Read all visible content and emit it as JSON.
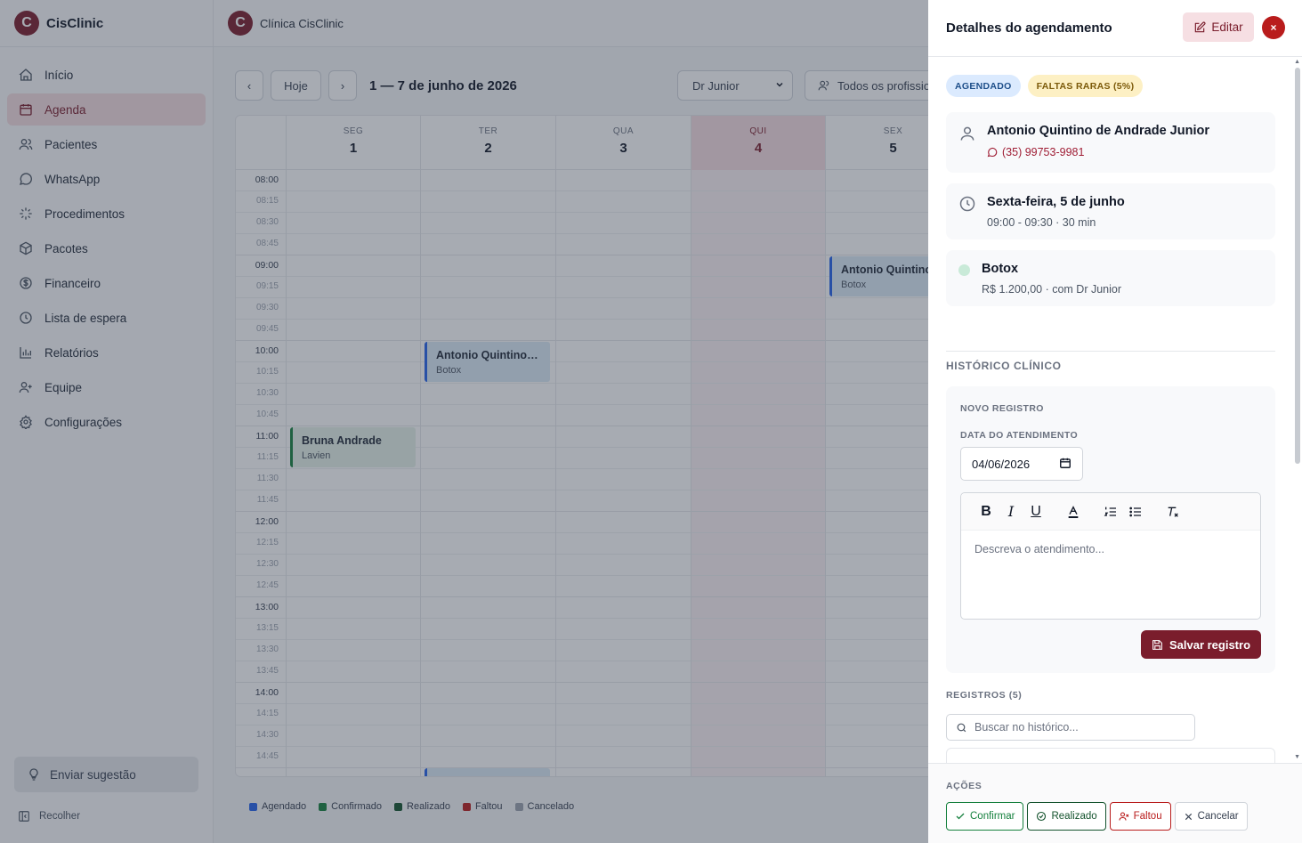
{
  "brand": {
    "name": "CisClinic",
    "logo_letter": "C",
    "color": "#7a1d2c"
  },
  "topbar": {
    "clinic_name": "Clínica CisClinic"
  },
  "sidebar": {
    "items": [
      {
        "label": "Início",
        "icon": "home-icon"
      },
      {
        "label": "Agenda",
        "icon": "calendar-icon",
        "active": true
      },
      {
        "label": "Pacientes",
        "icon": "users-icon"
      },
      {
        "label": "WhatsApp",
        "icon": "whatsapp-icon"
      },
      {
        "label": "Procedimentos",
        "icon": "sparkle-icon"
      },
      {
        "label": "Pacotes",
        "icon": "package-icon"
      },
      {
        "label": "Financeiro",
        "icon": "dollar-icon"
      },
      {
        "label": "Lista de espera",
        "icon": "clock-icon"
      },
      {
        "label": "Relatórios",
        "icon": "chart-icon"
      },
      {
        "label": "Equipe",
        "icon": "user-plus-icon"
      },
      {
        "label": "Configurações",
        "icon": "gear-icon"
      }
    ],
    "suggest_label": "Enviar sugestão",
    "collapse_label": "Recolher"
  },
  "calendar": {
    "today_label": "Hoje",
    "range_label": "1 — 7 de junho de 2026",
    "professional_select": "Dr Junior",
    "all_professionals": "Todos os profissionais",
    "days": [
      {
        "name": "SEG",
        "num": "1"
      },
      {
        "name": "TER",
        "num": "2"
      },
      {
        "name": "QUA",
        "num": "3"
      },
      {
        "name": "QUI",
        "num": "4",
        "today": true
      },
      {
        "name": "SEX",
        "num": "5"
      }
    ],
    "times": [
      "08:00",
      "08:15",
      "08:30",
      "08:45",
      "09:00",
      "09:15",
      "09:30",
      "09:45",
      "10:00",
      "10:15",
      "10:30",
      "10:45",
      "11:00",
      "11:15",
      "11:30",
      "11:45",
      "12:00",
      "12:15",
      "12:30",
      "12:45",
      "13:00",
      "13:15",
      "13:30",
      "13:45",
      "14:00",
      "14:15",
      "14:30",
      "14:45"
    ],
    "events": [
      {
        "day": 4,
        "start": "09:00",
        "end": "09:30",
        "name": "Antonio Quintino",
        "service": "Botox",
        "status": "agendado"
      },
      {
        "day": 1,
        "start": "10:00",
        "end": "10:30",
        "name": "Antonio Quintino d...",
        "service": "Botox",
        "status": "agendado"
      },
      {
        "day": 0,
        "start": "11:00",
        "end": "11:30",
        "name": "Bruna Andrade",
        "service": "Lavien",
        "status": "confirmado"
      }
    ],
    "legend": [
      {
        "label": "Agendado",
        "color": "#2563eb"
      },
      {
        "label": "Confirmado",
        "color": "#15803d"
      },
      {
        "label": "Realizado",
        "color": "#14532d"
      },
      {
        "label": "Faltou",
        "color": "#b91c1c"
      },
      {
        "label": "Cancelado",
        "color": "#9ca3af"
      }
    ]
  },
  "panel": {
    "title": "Detalhes do agendamento",
    "edit_label": "Editar",
    "close_label": "×",
    "badges": {
      "status": "AGENDADO",
      "attendance": "FALTAS RARAS (5%)"
    },
    "patient": {
      "name": "Antonio Quintino de Andrade Junior",
      "phone": "(35) 99753-9981"
    },
    "datetime": {
      "date": "Sexta-feira, 5 de junho",
      "time": "09:00 - 09:30 · 30 min"
    },
    "service": {
      "name": "Botox",
      "detail": "R$ 1.200,00 · com Dr Junior"
    },
    "history": {
      "title": "HISTÓRICO CLÍNICO",
      "new_record": "NOVO REGISTRO",
      "date_label": "DATA DO ATENDIMENTO",
      "date_value": "04/06/2026",
      "placeholder": "Descreva o atendimento...",
      "save_label": "Salvar registro",
      "records_label": "REGISTROS (5)",
      "search_placeholder": "Buscar no histórico..."
    },
    "actions": {
      "title": "AÇÕES",
      "confirm": "Confirmar",
      "done": "Realizado",
      "missed": "Faltou",
      "cancel": "Cancelar"
    }
  }
}
